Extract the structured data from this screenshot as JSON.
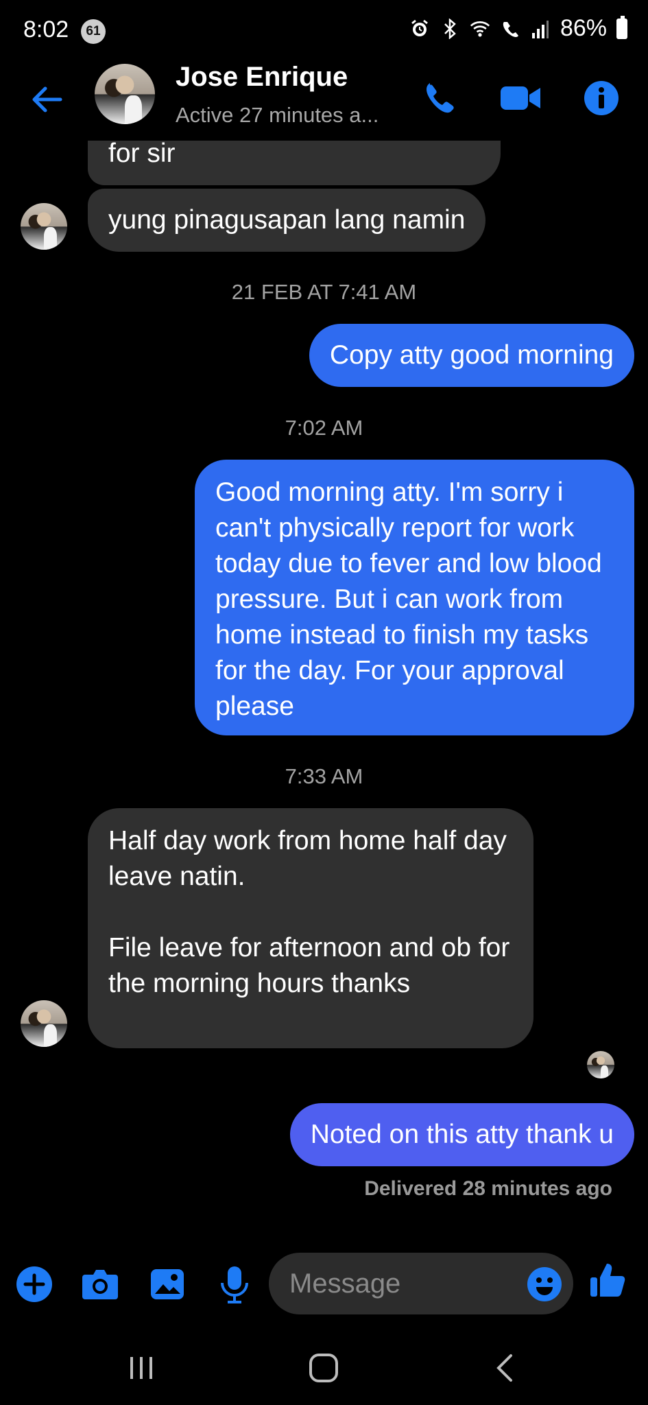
{
  "status_bar": {
    "time": "8:02",
    "notification_count": "61",
    "battery": "86%",
    "icons": [
      "alarm-icon",
      "bluetooth-icon",
      "wifi-icon",
      "wifi-calling-icon",
      "signal-icon",
      "battery-icon"
    ]
  },
  "header": {
    "contact_name": "Jose Enrique",
    "status": "Active 27 minutes a...",
    "icons": [
      "back-arrow-icon",
      "phone-icon",
      "video-camera-icon",
      "info-icon"
    ]
  },
  "messages": [
    {
      "type": "incoming",
      "text": "for sir"
    },
    {
      "type": "incoming",
      "text": "yung pinagusapan lang namin"
    },
    {
      "type": "timestamp",
      "text": "21 FEB AT 7:41 AM"
    },
    {
      "type": "outgoing",
      "text": "Copy atty good morning"
    },
    {
      "type": "timestamp",
      "text": "7:02 AM"
    },
    {
      "type": "outgoing",
      "text": "Good morning atty. I'm sorry i can't physically report for work today due to fever and low blood pressure. But i can work from home instead to finish my tasks for the day. For your approval please"
    },
    {
      "type": "timestamp",
      "text": "7:33 AM"
    },
    {
      "type": "incoming",
      "text": "Half day work from home half day leave natin.\n\nFile leave for afternoon and ob for the morning hours thanks"
    },
    {
      "type": "outgoing",
      "text": "Noted on this atty thank u"
    }
  ],
  "delivery_status": "Delivered 28 minutes ago",
  "composer": {
    "placeholder": "Message",
    "icons": [
      "plus-icon",
      "camera-icon",
      "gallery-icon",
      "microphone-icon",
      "emoji-icon",
      "thumbs-up-icon"
    ]
  },
  "colors": {
    "background": "#000000",
    "accent": "#2f6bf0",
    "incoming_bubble": "#303030",
    "outgoing_bubble": "#2f6bf0",
    "last_outgoing_bubble": "#4f5ff0",
    "icon_blue": "#1e7bf5"
  }
}
